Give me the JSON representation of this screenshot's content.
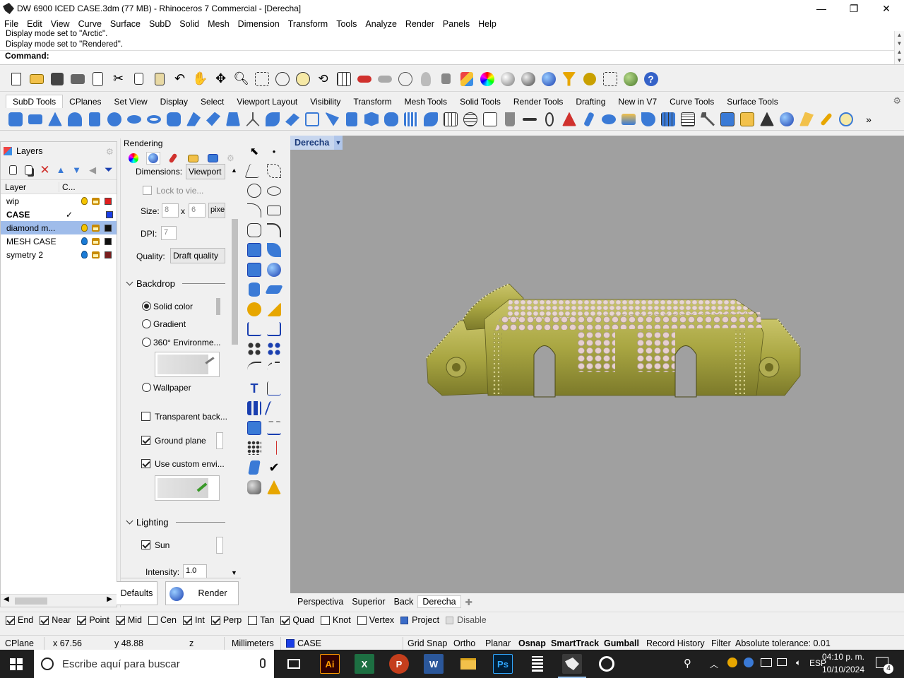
{
  "window": {
    "title": "DW 6900 ICED CASE.3dm (77 MB) - Rhinoceros 7 Commercial - [Derecha]",
    "controls": [
      "minimize-icon",
      "maximize-icon",
      "close-icon"
    ]
  },
  "menu": [
    "File",
    "Edit",
    "View",
    "Curve",
    "Surface",
    "SubD",
    "Solid",
    "Mesh",
    "Dimension",
    "Transform",
    "Tools",
    "Analyze",
    "Render",
    "Panels",
    "Help"
  ],
  "command": {
    "history": [
      "Display mode set to \"Arctic\".",
      "Display mode set to \"Rendered\"."
    ],
    "prompt": "Command:"
  },
  "toolbar_tabs": [
    "SubD Tools",
    "CPlanes",
    "Set View",
    "Display",
    "Select",
    "Viewport Layout",
    "Visibility",
    "Transform",
    "Mesh Tools",
    "Solid Tools",
    "Render Tools",
    "Drafting",
    "New in V7",
    "Curve Tools",
    "Surface Tools"
  ],
  "layers_panel": {
    "title": "Layers",
    "col_layer": "Layer",
    "col_current": "C...",
    "rows": [
      {
        "name": "wip",
        "current": "",
        "color": "#e01e1e",
        "bulb": "yellow"
      },
      {
        "name": "CASE",
        "current": "✓",
        "color": "#1a3ee6",
        "bulb": "none",
        "bold": true
      },
      {
        "name": "diamond m...",
        "current": "",
        "color": "#111111",
        "bulb": "yellow",
        "selected": true
      },
      {
        "name": "MESH CASE",
        "current": "",
        "color": "#111111",
        "bulb": "blue"
      },
      {
        "name": "symetry 2",
        "current": "",
        "color": "#7a1e1e",
        "bulb": "blue"
      }
    ]
  },
  "rendering_panel": {
    "title": "Rendering",
    "dimensions_label": "Dimensions:",
    "dimensions_value": "Viewport",
    "lock_label": "Lock to vie...",
    "size_label": "Size:",
    "size_w": "8",
    "size_x": "x",
    "size_h": "6",
    "size_unit": "pixe",
    "dpi_label": "DPI:",
    "dpi_value": "7",
    "quality_label": "Quality:",
    "quality_value": "Draft quality",
    "backdrop_header": "Backdrop",
    "solid_color": "Solid color",
    "gradient": "Gradient",
    "env360": "360° Environme...",
    "wallpaper": "Wallpaper",
    "transparent": "Transparent back...",
    "ground_plane": "Ground plane",
    "custom_env": "Use custom envi...",
    "lighting_header": "Lighting",
    "sun": "Sun",
    "intensity_label": "Intensity:",
    "intensity_value": "1.0",
    "defaults_button": "Defaults",
    "render_button": "Render"
  },
  "viewport": {
    "name": "Derecha",
    "background": "#a0a0a0",
    "model_color": "#a9a642",
    "tabs": [
      "Perspectiva",
      "Superior",
      "Back",
      "Derecha"
    ],
    "active_tab": "Derecha"
  },
  "osnap": [
    {
      "label": "End",
      "checked": true
    },
    {
      "label": "Near",
      "checked": true
    },
    {
      "label": "Point",
      "checked": true
    },
    {
      "label": "Mid",
      "checked": true
    },
    {
      "label": "Cen",
      "checked": false
    },
    {
      "label": "Int",
      "checked": true
    },
    {
      "label": "Perp",
      "checked": true
    },
    {
      "label": "Tan",
      "checked": false
    },
    {
      "label": "Quad",
      "checked": true
    },
    {
      "label": "Knot",
      "checked": false
    },
    {
      "label": "Vertex",
      "checked": false
    }
  ],
  "osnap_project": "Project",
  "osnap_disable": "Disable",
  "status": {
    "cplane": "CPlane",
    "x": "x 67.56",
    "y": "y 48.88",
    "z": "z",
    "units": "Millimeters",
    "layer": "CASE",
    "grid_snap": "Grid Snap",
    "ortho": "Ortho",
    "planar": "Planar",
    "osnap": "Osnap",
    "smarttrack": "SmartTrack",
    "gumball": "Gumball",
    "record_history": "Record History",
    "filter": "Filter",
    "tolerance": "Absolute tolerance: 0.01"
  },
  "taskbar": {
    "search_placeholder": "Escribe aquí para buscar",
    "lang": "ESP",
    "time": "04:10 p. m.",
    "date": "10/10/2024",
    "notif_count": "4"
  }
}
